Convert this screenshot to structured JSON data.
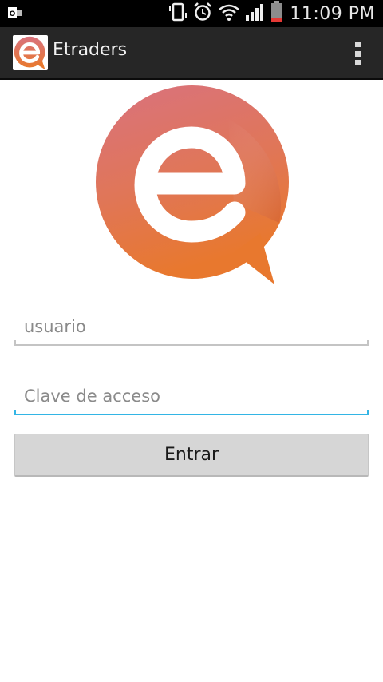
{
  "status_bar": {
    "time": "11:09 PM",
    "icons": [
      "outlook-mail-icon",
      "vibrate-icon",
      "alarm-icon",
      "wifi-icon",
      "signal-icon",
      "battery-icon"
    ]
  },
  "action_bar": {
    "title": "Etraders",
    "app_icon": "etraders-logo-icon",
    "overflow_icon": "overflow-menu-icon"
  },
  "logo": {
    "name": "etraders-logo",
    "colors": {
      "top": "#d9727e",
      "bottom": "#e8782e",
      "letter": "#ffffff"
    }
  },
  "form": {
    "username_placeholder": "usuario",
    "username_value": "",
    "password_placeholder": "Clave de acceso",
    "password_value": "",
    "submit_label": "Entrar"
  },
  "colors": {
    "accent_focus": "#33b5e5",
    "action_bar": "#262626",
    "button": "#d6d6d6"
  }
}
